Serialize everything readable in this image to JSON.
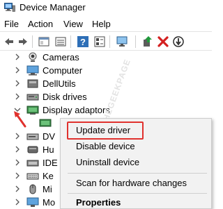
{
  "window": {
    "title": "Device Manager"
  },
  "menubar": {
    "items": [
      "File",
      "Action",
      "View",
      "Help"
    ]
  },
  "toolbar": {
    "buttons": [
      "back-icon",
      "forward-icon",
      "properties-pane-icon",
      "list-view-icon",
      "help-icon",
      "details-icon",
      "monitor-icon",
      "update-driver-icon",
      "uninstall-icon",
      "scan-hardware-icon"
    ]
  },
  "tree": {
    "items": [
      {
        "label": "Cameras",
        "icon": "camera-icon",
        "expanded": false
      },
      {
        "label": "Computer",
        "icon": "computer-icon",
        "expanded": false
      },
      {
        "label": "DellUtils",
        "icon": "dellutils-icon",
        "expanded": false
      },
      {
        "label": "Disk drives",
        "icon": "disk-drive-icon",
        "expanded": false
      },
      {
        "label": "Display adaptors",
        "icon": "display-adapter-icon",
        "expanded": true
      },
      {
        "label": "",
        "icon": "display-device-icon",
        "expanded": false
      },
      {
        "label": "DV",
        "icon": "dvd-icon",
        "expanded": false
      },
      {
        "label": "Hu",
        "icon": "human-interface-icon",
        "expanded": false
      },
      {
        "label": "IDE",
        "icon": "ide-icon",
        "expanded": false
      },
      {
        "label": "Ke",
        "icon": "keyboard-icon",
        "expanded": false
      },
      {
        "label": "Mi",
        "icon": "mice-icon",
        "expanded": false
      },
      {
        "label": "Mo",
        "icon": "monitor-icon",
        "expanded": false
      }
    ]
  },
  "watermark": {
    "text": "THEGEEKPAGE"
  },
  "context_menu": {
    "items": [
      {
        "label": "Update driver",
        "highlighted": true
      },
      {
        "label": "Disable device",
        "highlighted": false
      },
      {
        "label": "Uninstall device",
        "highlighted": false
      },
      {
        "label": "Scan for hardware changes",
        "highlighted": false
      },
      {
        "label": "Properties",
        "highlighted": false,
        "bold": true
      }
    ]
  },
  "colors": {
    "accent_red": "#e0312d",
    "menu_bg": "#f2f2f2",
    "toolbar_red_x": "#d42020"
  }
}
